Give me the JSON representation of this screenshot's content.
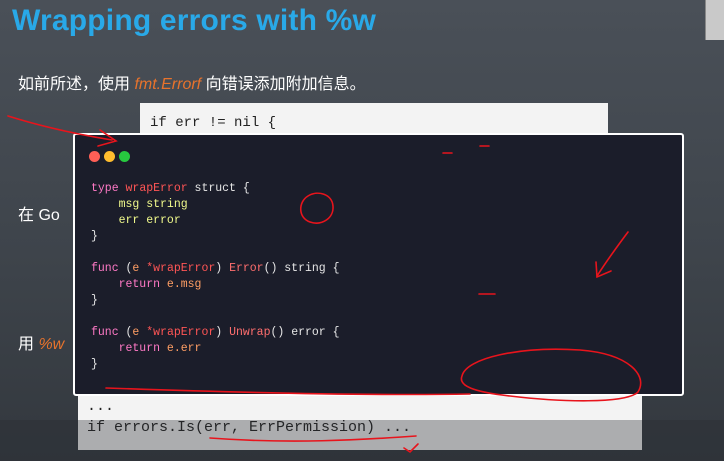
{
  "slide": {
    "title": "Wrapping errors with %w",
    "intro_prefix": "如前所述，使用 ",
    "intro_code": "fmt.Errorf",
    "intro_suffix": " 向错误添加附加信息。",
    "left_text_1": "在 Go",
    "left_text_2_prefix": "用 ",
    "left_text_2_code": "%w"
  },
  "background_code": {
    "line1": "if err != nil {"
  },
  "code_window": {
    "lines": [
      [
        {
          "t": "type ",
          "c": "kw"
        },
        {
          "t": "wrapError",
          "c": "tp"
        },
        {
          "t": " struct {",
          "c": "pl"
        }
      ],
      [
        {
          "t": "    ",
          "c": "pl"
        },
        {
          "t": "msg ",
          "c": "fd"
        },
        {
          "t": "string",
          "c": "ty"
        }
      ],
      [
        {
          "t": "    ",
          "c": "pl"
        },
        {
          "t": "err ",
          "c": "fd"
        },
        {
          "t": "error",
          "c": "ty"
        }
      ],
      [
        {
          "t": "}",
          "c": "pl"
        }
      ],
      [
        {
          "t": "",
          "c": "pl"
        }
      ],
      [
        {
          "t": "func ",
          "c": "kw"
        },
        {
          "t": "(",
          "c": "pl"
        },
        {
          "t": "e ",
          "c": "pn"
        },
        {
          "t": "*wrapError",
          "c": "tp"
        },
        {
          "t": ") ",
          "c": "pl"
        },
        {
          "t": "Error",
          "c": "fn"
        },
        {
          "t": "() string {",
          "c": "pl"
        }
      ],
      [
        {
          "t": "    return ",
          "c": "kw"
        },
        {
          "t": "e.msg",
          "c": "pn"
        }
      ],
      [
        {
          "t": "}",
          "c": "pl"
        }
      ],
      [
        {
          "t": "",
          "c": "pl"
        }
      ],
      [
        {
          "t": "func ",
          "c": "kw"
        },
        {
          "t": "(",
          "c": "pl"
        },
        {
          "t": "e ",
          "c": "pn"
        },
        {
          "t": "*wrapError",
          "c": "tp"
        },
        {
          "t": ") ",
          "c": "pl"
        },
        {
          "t": "Unwrap",
          "c": "fn"
        },
        {
          "t": "() error {",
          "c": "pl"
        }
      ],
      [
        {
          "t": "    return ",
          "c": "kw"
        },
        {
          "t": "e.err",
          "c": "pn"
        }
      ],
      [
        {
          "t": "}",
          "c": "pl"
        }
      ]
    ]
  },
  "bottom_code": {
    "line1": "...",
    "line2": "if errors.Is(err, ErrPermission) ..."
  },
  "colors": {
    "title": "#29a9e8",
    "highlight": "#e8732c",
    "annotation": "#e8141c"
  }
}
